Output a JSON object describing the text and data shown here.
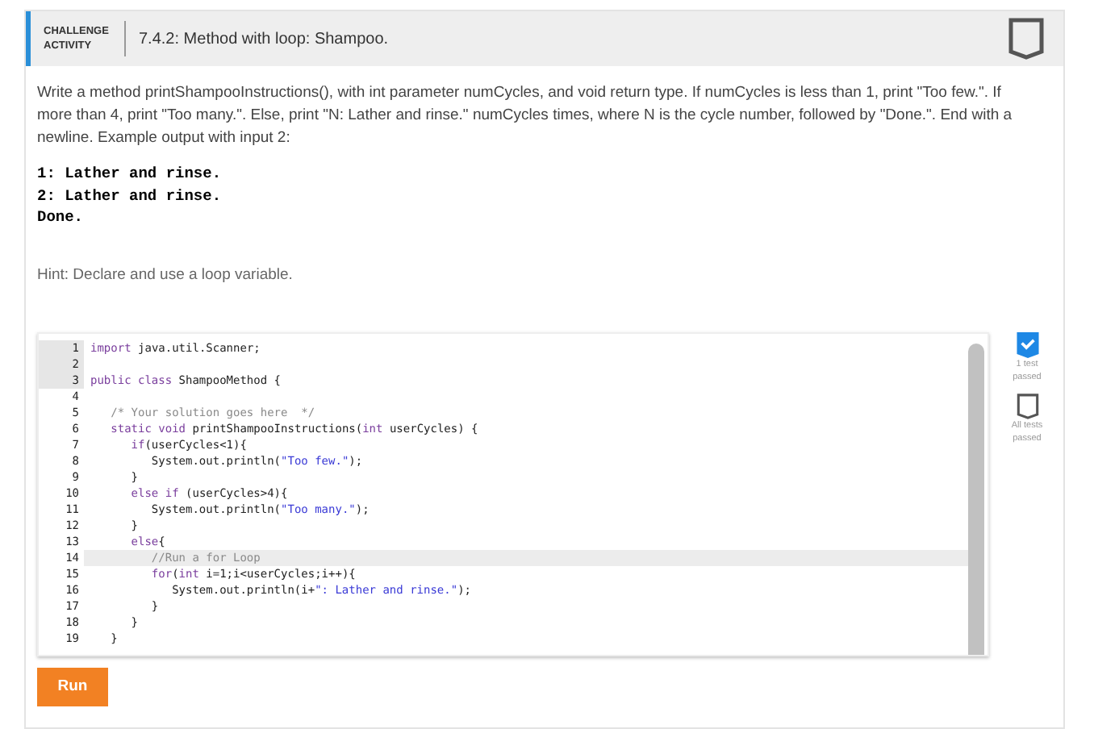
{
  "header": {
    "badge": "CHALLENGE ACTIVITY",
    "title": "7.4.2: Method with loop: Shampoo."
  },
  "instructions": "Write a method printShampooInstructions(), with int parameter numCycles, and void return type. If numCycles is less than 1, print \"Too few.\". If more than 4, print \"Too many.\". Else, print \"N: Lather and rinse.\" numCycles times, where N is the cycle number, followed by \"Done.\". End with a newline. Example output with input 2:",
  "example_output": [
    "1: Lather and rinse.",
    "2: Lather and rinse.",
    "Done."
  ],
  "hint": "Hint: Declare and use a loop variable.",
  "editor": {
    "lines": [
      {
        "number": "1",
        "readonly": true,
        "highlighted": false,
        "tokens": [
          {
            "kind": "kw",
            "text": "import"
          },
          {
            "kind": "plain",
            "text": " java.util.Scanner;"
          }
        ]
      },
      {
        "number": "2",
        "readonly": true,
        "highlighted": false
      },
      {
        "number": "3",
        "readonly": true,
        "highlighted": false,
        "tokens": [
          {
            "kind": "kw",
            "text": "public class"
          },
          {
            "kind": "plain",
            "text": " ShampooMethod {"
          }
        ]
      },
      {
        "number": "4",
        "readonly": false,
        "highlighted": false
      },
      {
        "number": "5",
        "readonly": false,
        "highlighted": false,
        "tokens": [
          {
            "kind": "comment",
            "text": "   /* Your solution goes here  */"
          }
        ]
      },
      {
        "number": "6",
        "readonly": false,
        "highlighted": false,
        "tokens": [
          {
            "kind": "kw",
            "text": "   static void"
          },
          {
            "kind": "plain",
            "text": " printShampooInstructions("
          },
          {
            "kind": "kw",
            "text": "int"
          },
          {
            "kind": "plain",
            "text": " userCycles) {"
          }
        ]
      },
      {
        "number": "7",
        "readonly": false,
        "highlighted": false,
        "tokens": [
          {
            "kind": "kw",
            "text": "      if"
          },
          {
            "kind": "plain",
            "text": "(userCycles<1){"
          }
        ]
      },
      {
        "number": "8",
        "readonly": false,
        "highlighted": false,
        "tokens": [
          {
            "kind": "plain",
            "text": "         System.out.println("
          },
          {
            "kind": "str",
            "text": "\"Too few.\""
          },
          {
            "kind": "plain",
            "text": ");"
          }
        ]
      },
      {
        "number": "9",
        "readonly": false,
        "highlighted": false,
        "tokens": [
          {
            "kind": "plain",
            "text": "      }"
          }
        ]
      },
      {
        "number": "10",
        "readonly": false,
        "highlighted": false,
        "tokens": [
          {
            "kind": "kw",
            "text": "      else if"
          },
          {
            "kind": "plain",
            "text": " (userCycles>4){"
          }
        ]
      },
      {
        "number": "11",
        "readonly": false,
        "highlighted": false,
        "tokens": [
          {
            "kind": "plain",
            "text": "         System.out.println("
          },
          {
            "kind": "str",
            "text": "\"Too many.\""
          },
          {
            "kind": "plain",
            "text": ");"
          }
        ]
      },
      {
        "number": "12",
        "readonly": false,
        "highlighted": false,
        "tokens": [
          {
            "kind": "plain",
            "text": "      }"
          }
        ]
      },
      {
        "number": "13",
        "readonly": false,
        "highlighted": false,
        "tokens": [
          {
            "kind": "kw",
            "text": "      else"
          },
          {
            "kind": "plain",
            "text": "{"
          }
        ]
      },
      {
        "number": "14",
        "readonly": false,
        "highlighted": true,
        "tokens": [
          {
            "kind": "comment",
            "text": "         //Run a for Loop"
          }
        ]
      },
      {
        "number": "15",
        "readonly": false,
        "highlighted": false,
        "tokens": [
          {
            "kind": "kw",
            "text": "         for"
          },
          {
            "kind": "plain",
            "text": "("
          },
          {
            "kind": "kw",
            "text": "int"
          },
          {
            "kind": "plain",
            "text": " i=1;i<userCycles;i++){"
          }
        ]
      },
      {
        "number": "16",
        "readonly": false,
        "highlighted": false,
        "tokens": [
          {
            "kind": "plain",
            "text": "            System.out.println(i+"
          },
          {
            "kind": "str",
            "text": "\": Lather and rinse.\""
          },
          {
            "kind": "plain",
            "text": ");"
          }
        ]
      },
      {
        "number": "17",
        "readonly": false,
        "highlighted": false,
        "tokens": [
          {
            "kind": "plain",
            "text": "         }"
          }
        ]
      },
      {
        "number": "18",
        "readonly": false,
        "highlighted": false,
        "tokens": [
          {
            "kind": "plain",
            "text": "      }"
          }
        ]
      },
      {
        "number": "19",
        "readonly": false,
        "highlighted": false,
        "tokens": [
          {
            "kind": "plain",
            "text": "   }"
          }
        ]
      }
    ]
  },
  "tests": [
    {
      "label": "1 test passed",
      "passed": true
    },
    {
      "label": "All tests passed",
      "passed": false
    }
  ],
  "run_button": "Run"
}
